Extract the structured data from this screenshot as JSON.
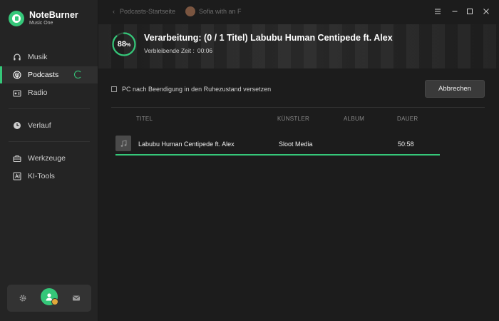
{
  "app": {
    "name": "NoteBurner",
    "subtitle": "Music One"
  },
  "sidebar": {
    "items": [
      {
        "label": "Musik",
        "icon": "headphones-icon"
      },
      {
        "label": "Podcasts",
        "icon": "podcast-icon",
        "active": true
      },
      {
        "label": "Radio",
        "icon": "radio-icon"
      },
      {
        "label": "Verlauf",
        "icon": "clock-icon"
      },
      {
        "label": "Werkzeuge",
        "icon": "toolbox-icon"
      },
      {
        "label": "KI-Tools",
        "icon": "ai-tools-icon"
      }
    ],
    "bottom": {
      "settings_icon": "gear-icon",
      "avatar_icon": "user-avatar-icon",
      "mail_icon": "mail-icon"
    }
  },
  "topbar": {
    "breadcrumb": "Podcasts-Startseite",
    "user_label": "Sofia with an F"
  },
  "processing": {
    "percent": "88",
    "percent_sign": "%",
    "title": "Verarbeitung: (0 / 1 Titel) Labubu Human Centipede ft. Alex",
    "remaining_label": "Verbleibende Zeit :",
    "remaining_value": "00:06",
    "progress_fraction": 0.88
  },
  "options": {
    "sleep_checkbox_label": "PC nach Beendigung in den Ruhezustand versetzen",
    "sleep_checked": false,
    "abort_label": "Abbrechen"
  },
  "table": {
    "headers": {
      "title": "TITEL",
      "artist": "KÜNSTLER",
      "album": "ALBUM",
      "duration": "DAUER"
    },
    "rows": [
      {
        "title": "Labubu Human Centipede ft. Alex",
        "artist": "Sloot Media",
        "album": "",
        "duration": "50:58"
      }
    ]
  },
  "colors": {
    "accent": "#35c779",
    "background": "#1c1c1c",
    "sidebar": "#242424"
  }
}
